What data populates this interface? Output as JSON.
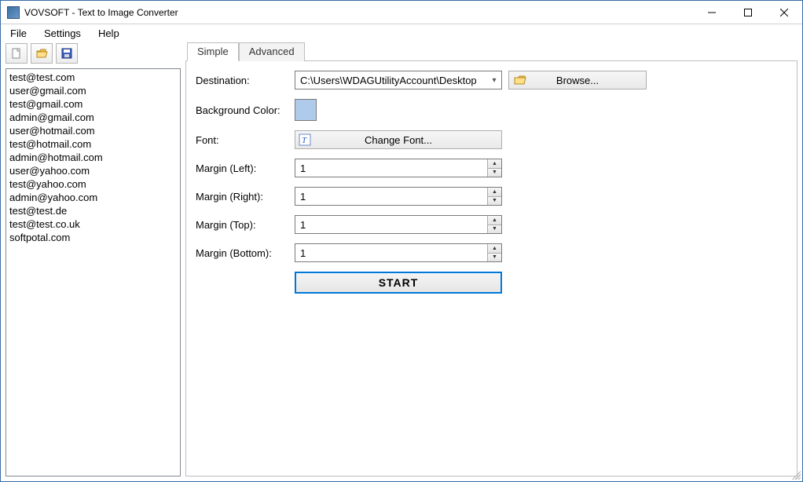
{
  "window": {
    "title": "VOVSOFT - Text to Image Converter"
  },
  "menu": {
    "file": "File",
    "settings": "Settings",
    "help": "Help"
  },
  "list": {
    "items": [
      "test@test.com",
      "user@gmail.com",
      "test@gmail.com",
      "admin@gmail.com",
      "user@hotmail.com",
      "test@hotmail.com",
      "admin@hotmail.com",
      "user@yahoo.com",
      "test@yahoo.com",
      "admin@yahoo.com",
      "test@test.de",
      "test@test.co.uk",
      "softpotal.com"
    ]
  },
  "tabs": {
    "simple": "Simple",
    "advanced": "Advanced"
  },
  "form": {
    "destination_label": "Destination:",
    "destination_value": "C:\\Users\\WDAGUtilityAccount\\Desktop",
    "browse_label": "Browse...",
    "bgcolor_label": "Background Color:",
    "bgcolor_value": "#aecbeb",
    "font_label": "Font:",
    "changefont_label": "Change Font...",
    "margin_left_label": "Margin (Left):",
    "margin_left_value": "1",
    "margin_right_label": "Margin (Right):",
    "margin_right_value": "1",
    "margin_top_label": "Margin (Top):",
    "margin_top_value": "1",
    "margin_bottom_label": "Margin (Bottom):",
    "margin_bottom_value": "1",
    "start_label": "START"
  }
}
